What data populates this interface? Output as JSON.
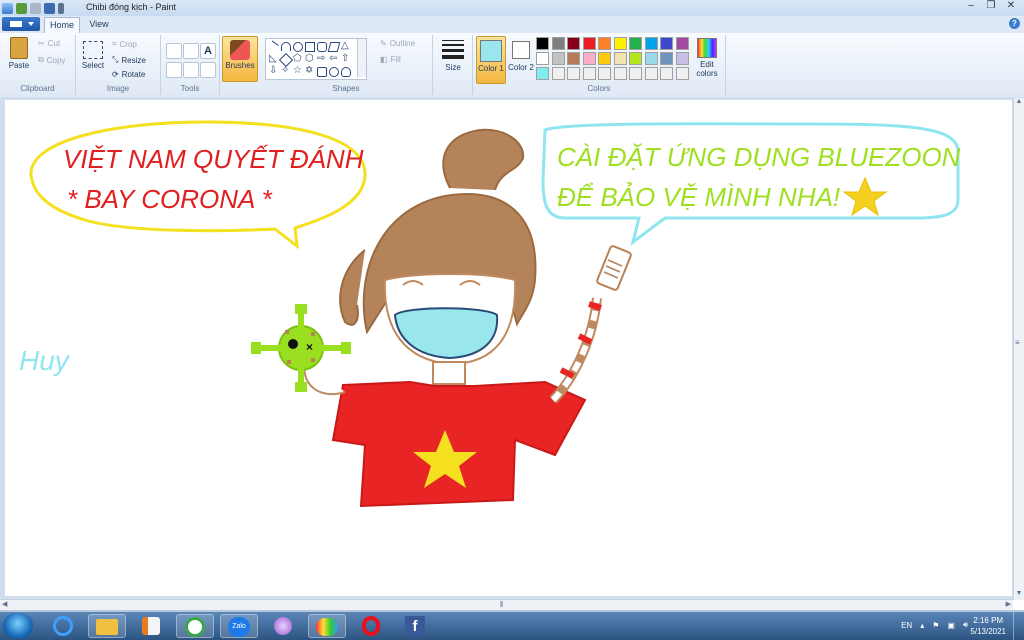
{
  "window": {
    "title": "Chibi đóng kịch - Paint",
    "controls": [
      "minimize",
      "restore",
      "close"
    ]
  },
  "tabs": [
    {
      "label": "Home",
      "active": true
    },
    {
      "label": "View",
      "active": false
    }
  ],
  "ribbon": {
    "clipboard": {
      "group_label": "Clipboard",
      "paste": "Paste",
      "cut": "Cut",
      "copy": "Copy"
    },
    "image": {
      "group_label": "Image",
      "select": "Select",
      "crop": "Crop",
      "resize": "Resize",
      "rotate": "Rotate"
    },
    "tools": {
      "group_label": "Tools"
    },
    "brushes": {
      "label": "Brushes"
    },
    "shapes": {
      "group_label": "Shapes",
      "outline": "Outline",
      "fill": "Fill"
    },
    "size": {
      "label": "Size"
    },
    "colors": {
      "group_label": "Colors",
      "color1": "Color 1",
      "color2": "Color 2",
      "edit": "Edit colors",
      "color1_value": "#99e6ec",
      "color2_value": "#ffffff",
      "palette_row1": [
        "#000000",
        "#7f7f7f",
        "#880015",
        "#ed1c24",
        "#ff7f27",
        "#fff200",
        "#22b14c",
        "#00a2e8",
        "#3f48cc",
        "#a349a4"
      ],
      "palette_row2": [
        "#ffffff",
        "#c3c3c3",
        "#b97a57",
        "#ffaec9",
        "#ffc90e",
        "#efe4b0",
        "#b5e61d",
        "#99d9ea",
        "#7092be",
        "#c8bfe7"
      ],
      "palette_row3": [
        "#7fecef",
        "#f0f0f0",
        "#f0f0f0",
        "#f0f0f0",
        "#f0f0f0",
        "#f0f0f0",
        "#f0f0f0",
        "#f0f0f0",
        "#f0f0f0",
        "#f0f0f0"
      ]
    }
  },
  "canvas": {
    "bubble_left_line1": "VIỆT NAM QUYẾT ĐÁNH",
    "bubble_left_line2": "* BAY  CORONA *",
    "bubble_right_line1": "CÀI ĐẶT ỨNG DỤNG BLUEZOON",
    "bubble_right_line2": "ĐỂ BẢO VỆ MÌNH NHA!",
    "signature": "Huy"
  },
  "taskbar": {
    "apps": [
      "ie-icon",
      "file-explorer-icon",
      "media-player-icon",
      "browser-icon",
      "zalo-icon",
      "flower-app-icon",
      "paint-icon",
      "opera-icon",
      "facebook-icon"
    ],
    "zalo_label": "Zalo",
    "language": "EN",
    "time": "2:16 PM",
    "date": "5/13/2021"
  }
}
